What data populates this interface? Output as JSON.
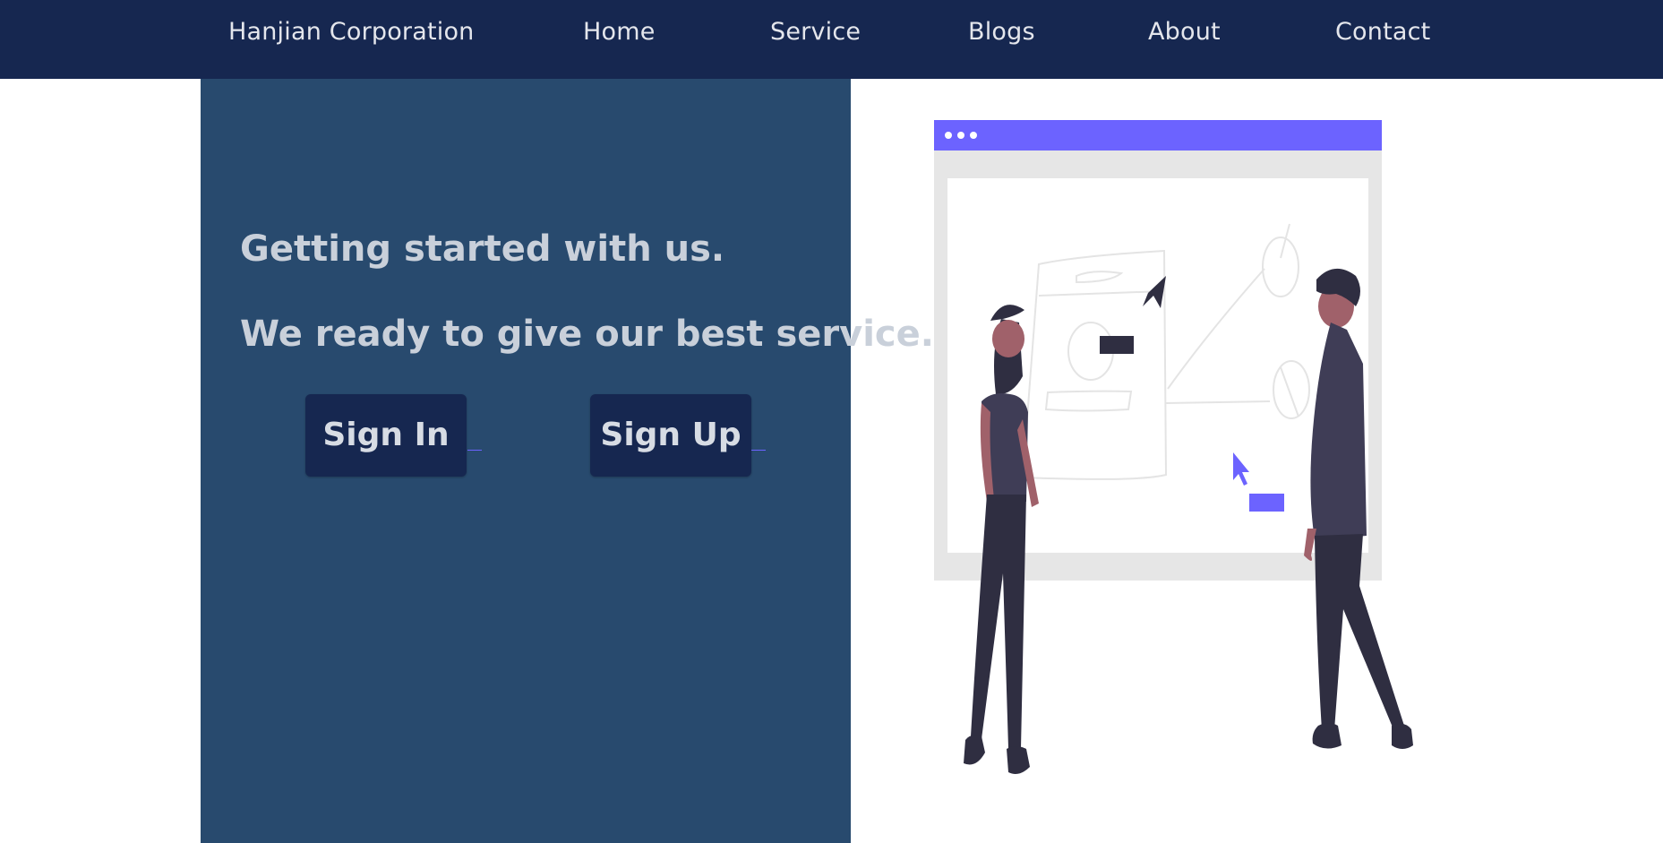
{
  "nav": {
    "brand": "Hanjian Corporation",
    "links": [
      "Home",
      "Service",
      "Blogs",
      "About",
      "Contact"
    ]
  },
  "hero": {
    "headline": "Getting started with us.",
    "subheadline": "We ready to give our best service.",
    "signin_label": "Sign In",
    "signup_label": "Sign Up"
  },
  "colors": {
    "nav_bg": "#162750",
    "panel_bg": "#284a6e",
    "button_bg": "#162750",
    "accent": "#6c63ff",
    "ink": "#2f2e41"
  },
  "illustration": {
    "icon": "two-people-at-whiteboard-illustration"
  }
}
